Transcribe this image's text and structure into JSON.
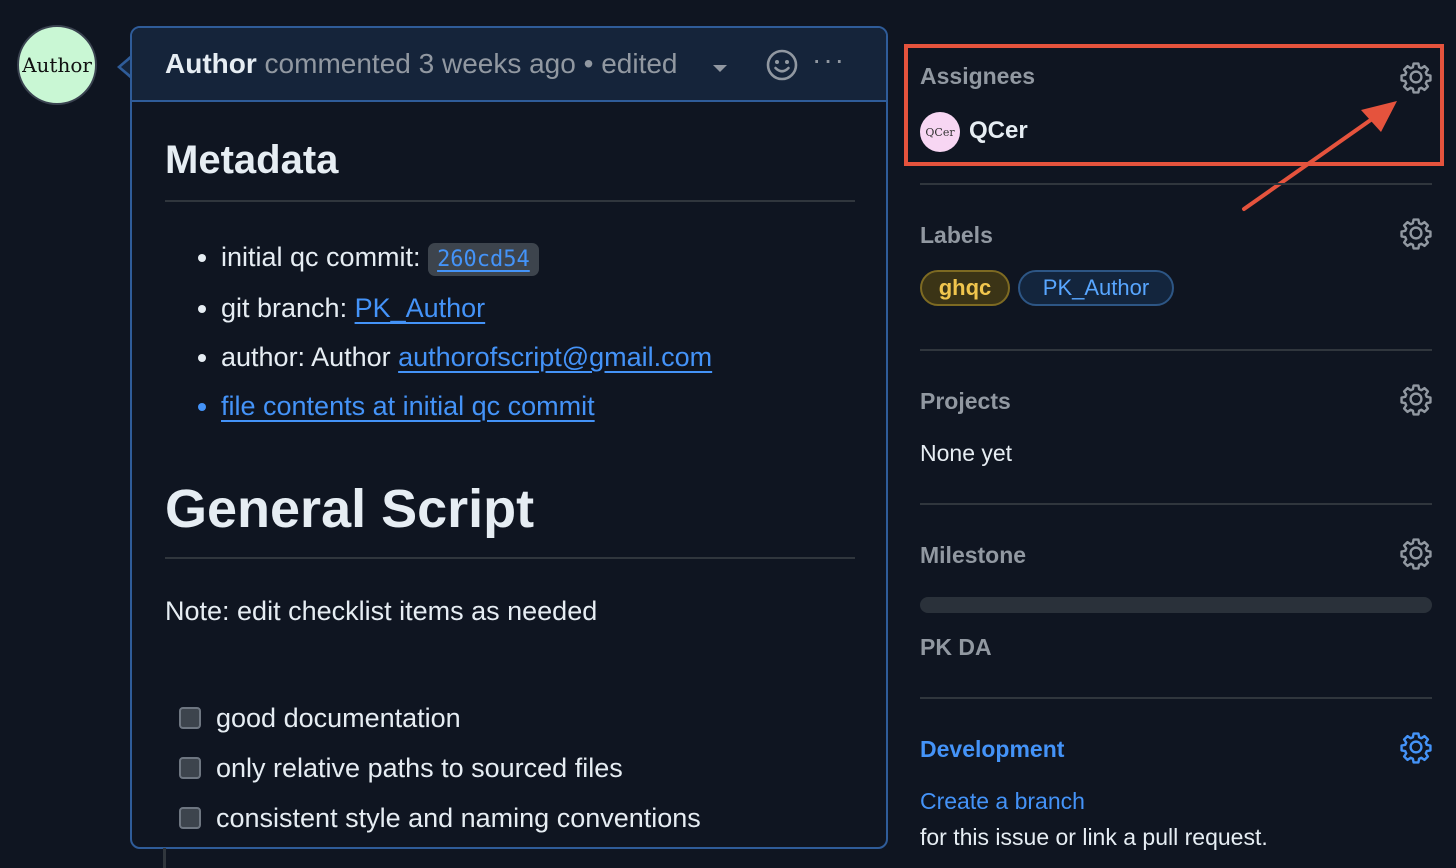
{
  "comment": {
    "author_avatar_text": "Author",
    "author": "Author",
    "meta_text": "commented 3 weeks ago",
    "separator": "•",
    "edited": "edited",
    "more": "···",
    "metadata_heading": "Metadata",
    "metadata_items": [
      {
        "label": "initial qc commit: ",
        "value": "260cd54"
      },
      {
        "label": "git branch: ",
        "value": "PK_Author"
      },
      {
        "label": "author: Author ",
        "value": "authorofscript@gmail.com"
      },
      {
        "label": "",
        "value": "file contents at initial qc commit"
      }
    ],
    "script_heading": "General Script",
    "note": "Note: edit checklist items as needed",
    "checklist": [
      "good documentation",
      "only relative paths to sourced files",
      "consistent style and naming conventions"
    ]
  },
  "sidebar": {
    "assignees_title": "Assignees",
    "assignee_avatar_text": "QCer",
    "assignee_name": "QCer",
    "labels_title": "Labels",
    "labels": [
      "ghqc",
      "PK_Author"
    ],
    "projects_title": "Projects",
    "projects_value": "None yet",
    "milestone_title": "Milestone",
    "milestone_progress": 0.0,
    "milestone_name": "PK DA",
    "development_title": "Development",
    "development_link": "Create a branch",
    "development_text": "for this issue or link a pull request."
  },
  "colors": {
    "background": "#0f1521",
    "accent_link": "#4493f8",
    "highlight": "#e5533d",
    "comment_border": "#2f5c99"
  }
}
